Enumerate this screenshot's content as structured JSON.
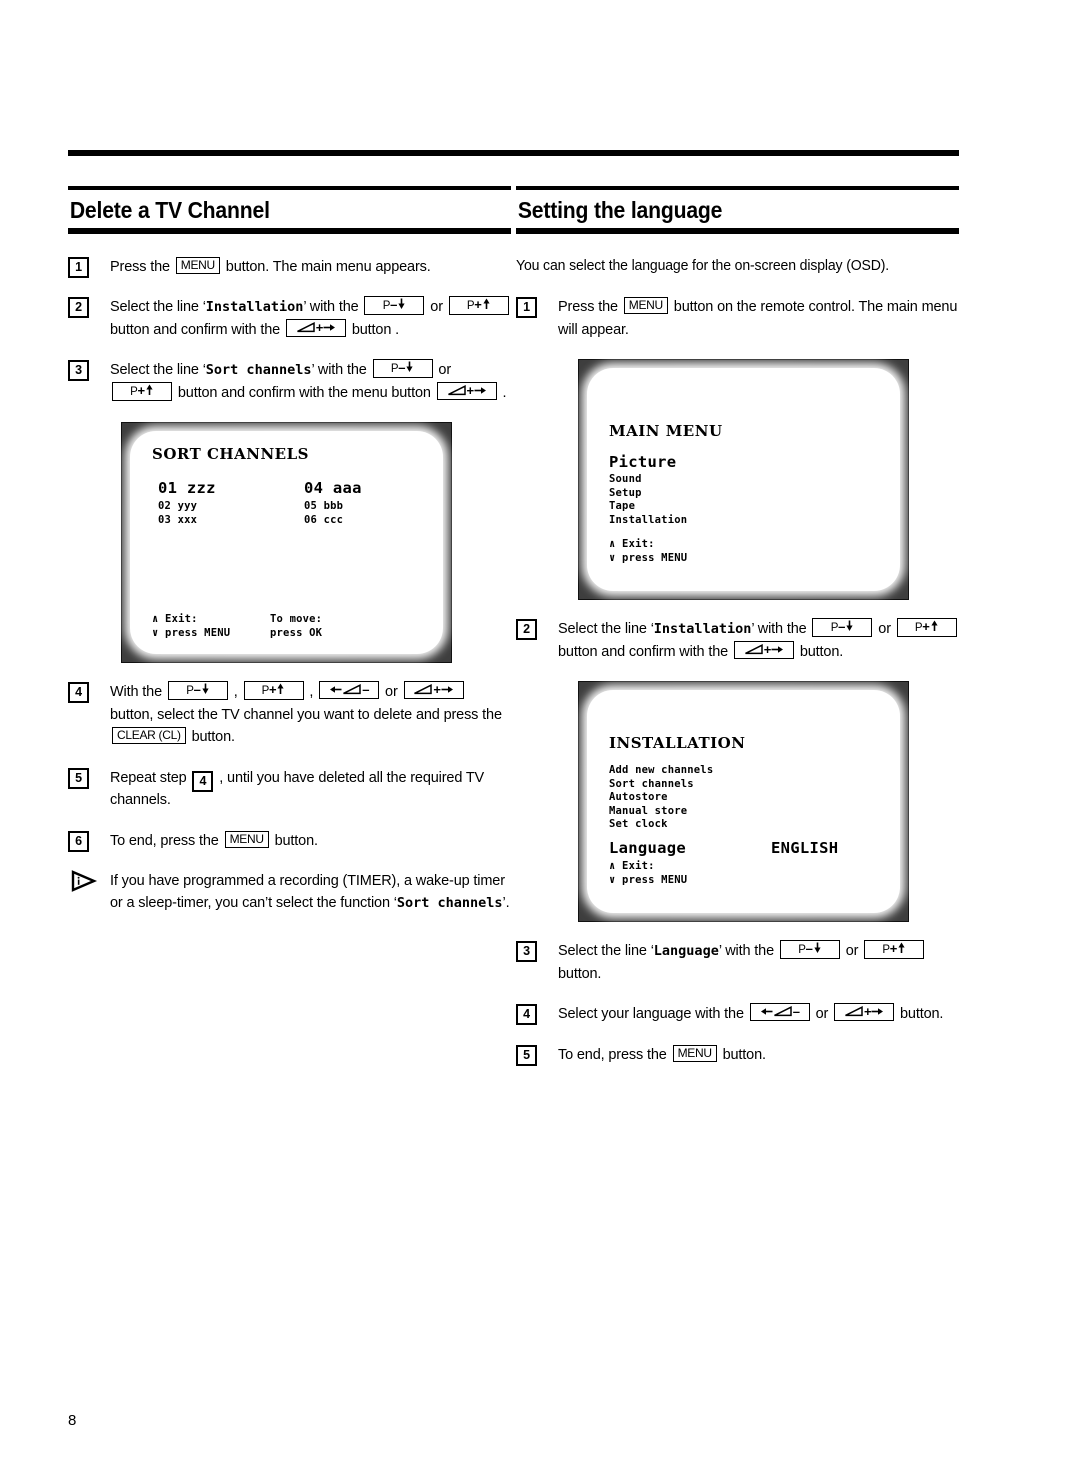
{
  "page": {
    "number": "8"
  },
  "left_column": {
    "heading": "Delete a TV Channel",
    "steps": [
      {
        "num": "1",
        "parts": [
          {
            "t": "text",
            "v": "Press the "
          },
          {
            "t": "key",
            "v": "MENU"
          },
          {
            "t": "text",
            "v": " button. The main menu appears."
          }
        ]
      },
      {
        "num": "2",
        "parts": [
          {
            "t": "text",
            "v": "Select the line ‘"
          },
          {
            "t": "mono",
            "v": "Installation"
          },
          {
            "t": "text",
            "v": "’ with the "
          },
          {
            "t": "key-pdown",
            "v": "P−↓"
          },
          {
            "t": "text",
            "v": " or "
          },
          {
            "t": "key-pup",
            "v": "P+↑"
          },
          {
            "t": "text",
            "v": " button and confirm with the "
          },
          {
            "t": "key-volup",
            "v": "◢+→"
          },
          {
            "t": "text",
            "v": " button ."
          }
        ]
      },
      {
        "num": "3",
        "parts": [
          {
            "t": "text",
            "v": "Select the line ‘"
          },
          {
            "t": "mono",
            "v": "Sort channels"
          },
          {
            "t": "text",
            "v": "’ with the "
          },
          {
            "t": "key-pdown",
            "v": "P−↓"
          },
          {
            "t": "text",
            "v": " or "
          },
          {
            "t": "key-pup",
            "v": "P+↑"
          },
          {
            "t": "text",
            "v": " button and confirm with the menu button "
          },
          {
            "t": "key-volup",
            "v": "◢+→"
          },
          {
            "t": "text",
            "v": " ."
          }
        ]
      },
      {
        "num": "4",
        "parts": [
          {
            "t": "text",
            "v": "With the "
          },
          {
            "t": "key-pdown",
            "v": "P−↓"
          },
          {
            "t": "text",
            "v": " , "
          },
          {
            "t": "key-pup",
            "v": "P+↑"
          },
          {
            "t": "text",
            "v": " , "
          },
          {
            "t": "key-voldown",
            "v": "←◢−"
          },
          {
            "t": "text",
            "v": " or "
          },
          {
            "t": "key-volup",
            "v": "◢+→"
          },
          {
            "t": "text",
            "v": " button, select the TV channel you want to delete and press the "
          },
          {
            "t": "key",
            "v": "CLEAR (CL)"
          },
          {
            "t": "text",
            "v": " button."
          }
        ]
      },
      {
        "num": "5",
        "parts": [
          {
            "t": "text",
            "v": "Repeat step "
          },
          {
            "t": "stepnum",
            "v": "4"
          },
          {
            "t": "text",
            "v": " ,  until you have deleted all the required TV channels."
          }
        ]
      },
      {
        "num": "6",
        "parts": [
          {
            "t": "text",
            "v": "To end, press the "
          },
          {
            "t": "key",
            "v": "MENU"
          },
          {
            "t": "text",
            "v": " button."
          }
        ]
      }
    ],
    "note": {
      "icon": "info-triangle-icon",
      "parts": [
        {
          "t": "text",
          "v": "If you have programmed a recording (TIMER), a wake-up timer or a sleep-timer, you can’t select the function ‘"
        },
        {
          "t": "mono",
          "v": "Sort channels"
        },
        {
          "t": "text",
          "v": "’."
        }
      ]
    },
    "tv_screen": {
      "name": "sort-channels-osd",
      "title": "SORT CHANNELS",
      "columns": [
        [
          {
            "num": "01",
            "label": "zzz",
            "highlight": true
          },
          {
            "num": "02",
            "label": "yyy",
            "highlight": false
          },
          {
            "num": "03",
            "label": "xxx",
            "highlight": false
          }
        ],
        [
          {
            "num": "04",
            "label": "aaa",
            "highlight": true
          },
          {
            "num": "05",
            "label": "bbb",
            "highlight": false
          },
          {
            "num": "06",
            "label": "ccc",
            "highlight": false
          }
        ]
      ],
      "footer": {
        "line1_col1": "∧ Exit:",
        "line1_col2": "To move:",
        "line2_col1": "∨ press MENU",
        "line2_col2": "press OK"
      }
    }
  },
  "right_column": {
    "heading": "Setting the language",
    "intro": "You can select the language for the on-screen display (OSD).",
    "steps": [
      {
        "num": "1",
        "parts": [
          {
            "t": "text",
            "v": "Press the "
          },
          {
            "t": "key",
            "v": "MENU"
          },
          {
            "t": "text",
            "v": " button on the remote control. The main menu will appear."
          }
        ]
      },
      {
        "num": "2",
        "parts": [
          {
            "t": "text",
            "v": "Select the line ‘"
          },
          {
            "t": "mono",
            "v": "Installation"
          },
          {
            "t": "text",
            "v": "’ with the "
          },
          {
            "t": "key-pdown",
            "v": "P−↓"
          },
          {
            "t": "text",
            "v": " or "
          },
          {
            "t": "key-pup",
            "v": "P+↑"
          },
          {
            "t": "text",
            "v": " button and confirm with the "
          },
          {
            "t": "key-volup",
            "v": "◢+→"
          },
          {
            "t": "text",
            "v": " button."
          }
        ]
      },
      {
        "num": "3",
        "parts": [
          {
            "t": "text",
            "v": "Select the line ‘"
          },
          {
            "t": "mono",
            "v": "Language"
          },
          {
            "t": "text",
            "v": "’ with the "
          },
          {
            "t": "key-pdown",
            "v": "P−↓"
          },
          {
            "t": "text",
            "v": " or "
          },
          {
            "t": "key-pup",
            "v": "P+↑"
          },
          {
            "t": "text",
            "v": " button."
          }
        ]
      },
      {
        "num": "4",
        "parts": [
          {
            "t": "text",
            "v": "Select your language with the "
          },
          {
            "t": "key-voldown",
            "v": "←◢−"
          },
          {
            "t": "text",
            "v": " or "
          },
          {
            "t": "key-volup",
            "v": "◢+→"
          },
          {
            "t": "text",
            "v": " button."
          }
        ]
      },
      {
        "num": "5",
        "parts": [
          {
            "t": "text",
            "v": "To end, press the "
          },
          {
            "t": "key",
            "v": "MENU"
          },
          {
            "t": "text",
            "v": " button."
          }
        ]
      }
    ],
    "tv_screen_main": {
      "name": "main-menu-osd",
      "title": "MAIN MENU",
      "selected_item": "Picture",
      "items": [
        "Sound",
        "Setup",
        "Tape",
        "Installation"
      ],
      "footer": {
        "line1": "∧ Exit:",
        "line2": "∨ press MENU"
      }
    },
    "tv_screen_installation": {
      "name": "installation-osd",
      "title": "INSTALLATION",
      "items": [
        "Add new channels",
        "Sort channels",
        "Autostore",
        "Manual store",
        "Set clock"
      ],
      "language_row": {
        "label": "Language",
        "value": "ENGLISH"
      },
      "footer": {
        "line1": "∧ Exit:",
        "line2": "∨ press MENU"
      }
    }
  }
}
